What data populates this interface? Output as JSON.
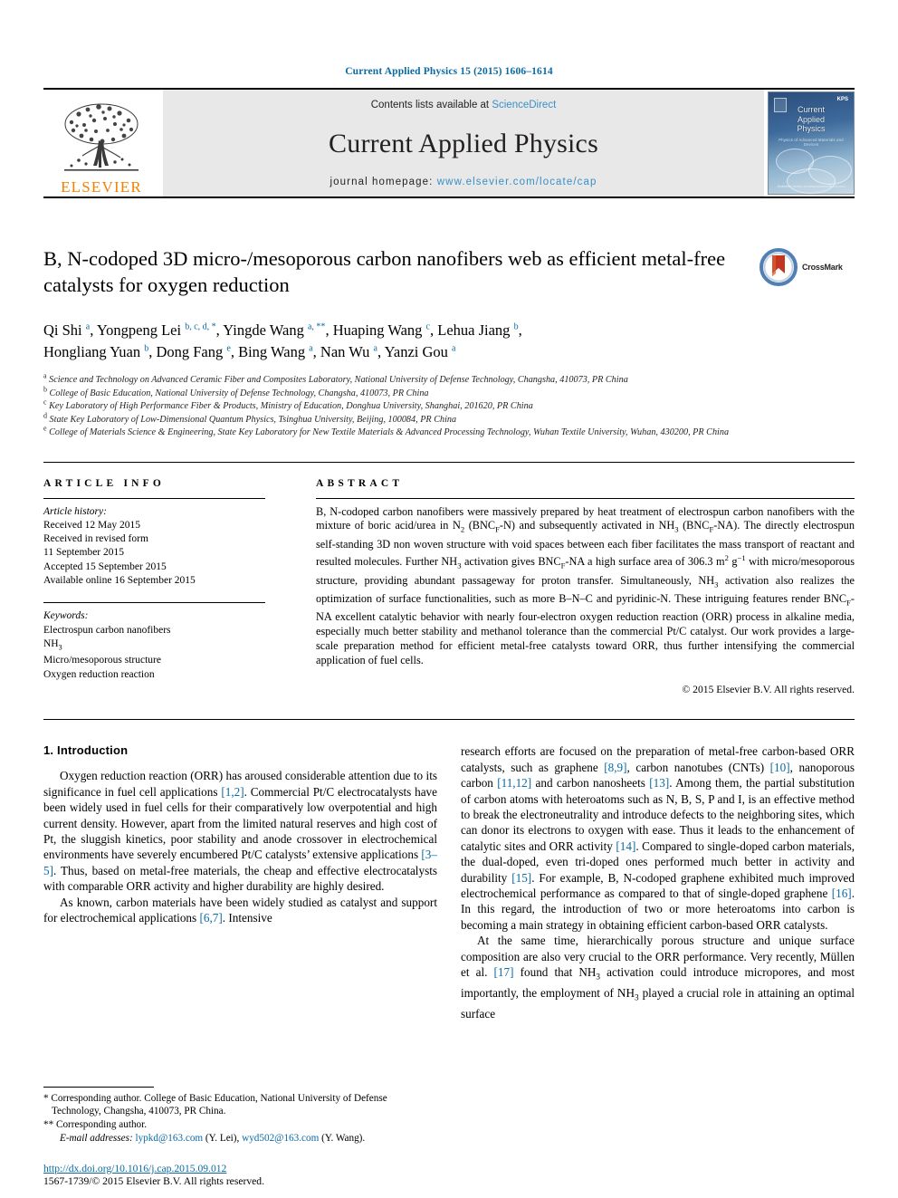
{
  "running_head": "Current Applied Physics 15 (2015) 1606–1614",
  "masthead": {
    "contents_prefix": "Contents lists available at ",
    "sciencedirect": "ScienceDirect",
    "journal_title": "Current Applied Physics",
    "homepage_prefix": "journal homepage: ",
    "homepage_url": "www.elsevier.com/locate/cap",
    "publisher": "ELSEVIER",
    "cover": {
      "title_line1": "Current",
      "title_line2": "Applied",
      "title_line3": "Physics",
      "subtitle": "Physics of Advanced Materials and Devices",
      "kps": "KPS",
      "footer": "Available online at www.sciencedirect.com"
    },
    "crossmark_label": "CrossMark"
  },
  "article": {
    "title": "B, N-codoped 3D micro-/mesoporous carbon nanofibers web as efficient metal-free catalysts for oxygen reduction",
    "authors_line1_segments": [
      {
        "name": "Qi Shi ",
        "sup": "a"
      },
      {
        "name": ", Yongpeng Lei ",
        "sup": "b, c, d, *"
      },
      {
        "name": ", Yingde Wang ",
        "sup": "a, **"
      },
      {
        "name": ", Huaping Wang ",
        "sup": "c"
      },
      {
        "name": ", Lehua Jiang ",
        "sup": "b"
      }
    ],
    "authors_line2_segments": [
      {
        "name": "Hongliang Yuan ",
        "sup": "b"
      },
      {
        "name": ", Dong Fang ",
        "sup": "e"
      },
      {
        "name": ", Bing Wang ",
        "sup": "a"
      },
      {
        "name": ", Nan Wu ",
        "sup": "a"
      },
      {
        "name": ", Yanzi Gou ",
        "sup": "a"
      }
    ],
    "affiliations": [
      {
        "mark": "a",
        "text": "Science and Technology on Advanced Ceramic Fiber and Composites Laboratory, National University of Defense Technology, Changsha, 410073, PR China"
      },
      {
        "mark": "b",
        "text": "College of Basic Education, National University of Defense Technology, Changsha, 410073, PR China"
      },
      {
        "mark": "c",
        "text": "Key Laboratory of High Performance Fiber & Products, Ministry of Education, Donghua University, Shanghai, 201620, PR China"
      },
      {
        "mark": "d",
        "text": "State Key Laboratory of Low-Dimensional Quantum Physics, Tsinghua University, Beijing, 100084, PR China"
      },
      {
        "mark": "e",
        "text": "College of Materials Science & Engineering, State Key Laboratory for New Textile Materials & Advanced Processing Technology, Wuhan Textile University, Wuhan, 430200, PR China"
      }
    ]
  },
  "article_info": {
    "heading": "ARTICLE INFO",
    "history_label": "Article history:",
    "history": [
      "Received 12 May 2015",
      "Received in revised form",
      "11 September 2015",
      "Accepted 15 September 2015",
      "Available online 16 September 2015"
    ],
    "keywords_label": "Keywords:",
    "keywords": [
      "Electrospun carbon nanofibers",
      "NH3",
      "Micro/mesoporous structure",
      "Oxygen reduction reaction"
    ]
  },
  "abstract": {
    "heading": "ABSTRACT",
    "text": "B, N-codoped carbon nanofibers were massively prepared by heat treatment of electrospun carbon nanofibers with the mixture of boric acid/urea in N2 (BNCF-N) and subsequently activated in NH3 (BNCF-NA). The directly electrospun self-standing 3D non woven structure with void spaces between each fiber facilitates the mass transport of reactant and resulted molecules. Further NH3 activation gives BNCF-NA a high surface area of 306.3 m2 g−1 with micro/mesoporous structure, providing abundant passageway for proton transfer. Simultaneously, NH3 activation also realizes the optimization of surface functionalities, such as more B–N–C and pyridinic-N. These intriguing features render BNCF-NA excellent catalytic behavior with nearly four-electron oxygen reduction reaction (ORR) process in alkaline media, especially much better stability and methanol tolerance than the commercial Pt/C catalyst. Our work provides a large-scale preparation method for efficient metal-free catalysts toward ORR, thus further intensifying the commercial application of fuel cells.",
    "copyright": "© 2015 Elsevier B.V. All rights reserved."
  },
  "introduction": {
    "heading": "1. Introduction",
    "left_paragraphs": [
      "Oxygen reduction reaction (ORR) has aroused considerable attention due to its significance in fuel cell applications [1,2]. Commercial Pt/C electrocatalysts have been widely used in fuel cells for their comparatively low overpotential and high current density. However, apart from the limited natural reserves and high cost of Pt, the sluggish kinetics, poor stability and anode crossover in electrochemical environments have severely encumbered Pt/C catalysts' extensive applications [3–5]. Thus, based on metal-free materials, the cheap and effective electrocatalysts with comparable ORR activity and higher durability are highly desired.",
      "As known, carbon materials have been widely studied as catalyst and support for electrochemical applications [6,7]. Intensive"
    ],
    "right_paragraphs": [
      "research efforts are focused on the preparation of metal-free carbon-based ORR catalysts, such as graphene [8,9], carbon nanotubes (CNTs) [10], nanoporous carbon [11,12] and carbon nanosheets [13]. Among them, the partial substitution of carbon atoms with heteroatoms such as N, B, S, P and I, is an effective method to break the electroneutrality and introduce defects to the neighboring sites, which can donor its electrons to oxygen with ease. Thus it leads to the enhancement of catalytic sites and ORR activity [14]. Compared to single-doped carbon materials, the dual-doped, even tri-doped ones performed much better in activity and durability [15]. For example, B, N-codoped graphene exhibited much improved electrochemical performance as compared to that of single-doped graphene [16]. In this regard, the introduction of two or more heteroatoms into carbon is becoming a main strategy in obtaining efficient carbon-based ORR catalysts.",
      "At the same time, hierarchically porous structure and unique surface composition are also very crucial to the ORR performance. Very recently, Müllen et al. [17] found that NH3 activation could introduce micropores, and most importantly, the employment of NH3 played a crucial role in attaining an optimal surface"
    ]
  },
  "footnotes": {
    "corresponding1": "* Corresponding author. College of Basic Education, National University of Defense Technology, Changsha, 410073, PR China.",
    "corresponding2": "** Corresponding author.",
    "email_label": "E-mail addresses:",
    "email1": "lypkd@163.com",
    "email1_owner": "(Y. Lei)",
    "email2": "wyd502@163.com",
    "email2_owner": "(Y. Wang)",
    "doi": "http://dx.doi.org/10.1016/j.cap.2015.09.012",
    "issn_line": "1567-1739/© 2015 Elsevier B.V. All rights reserved."
  },
  "colors": {
    "link": "#0b6aa2",
    "sciencedirect": "#3a8fc4",
    "elsevier_orange": "#f28100"
  }
}
